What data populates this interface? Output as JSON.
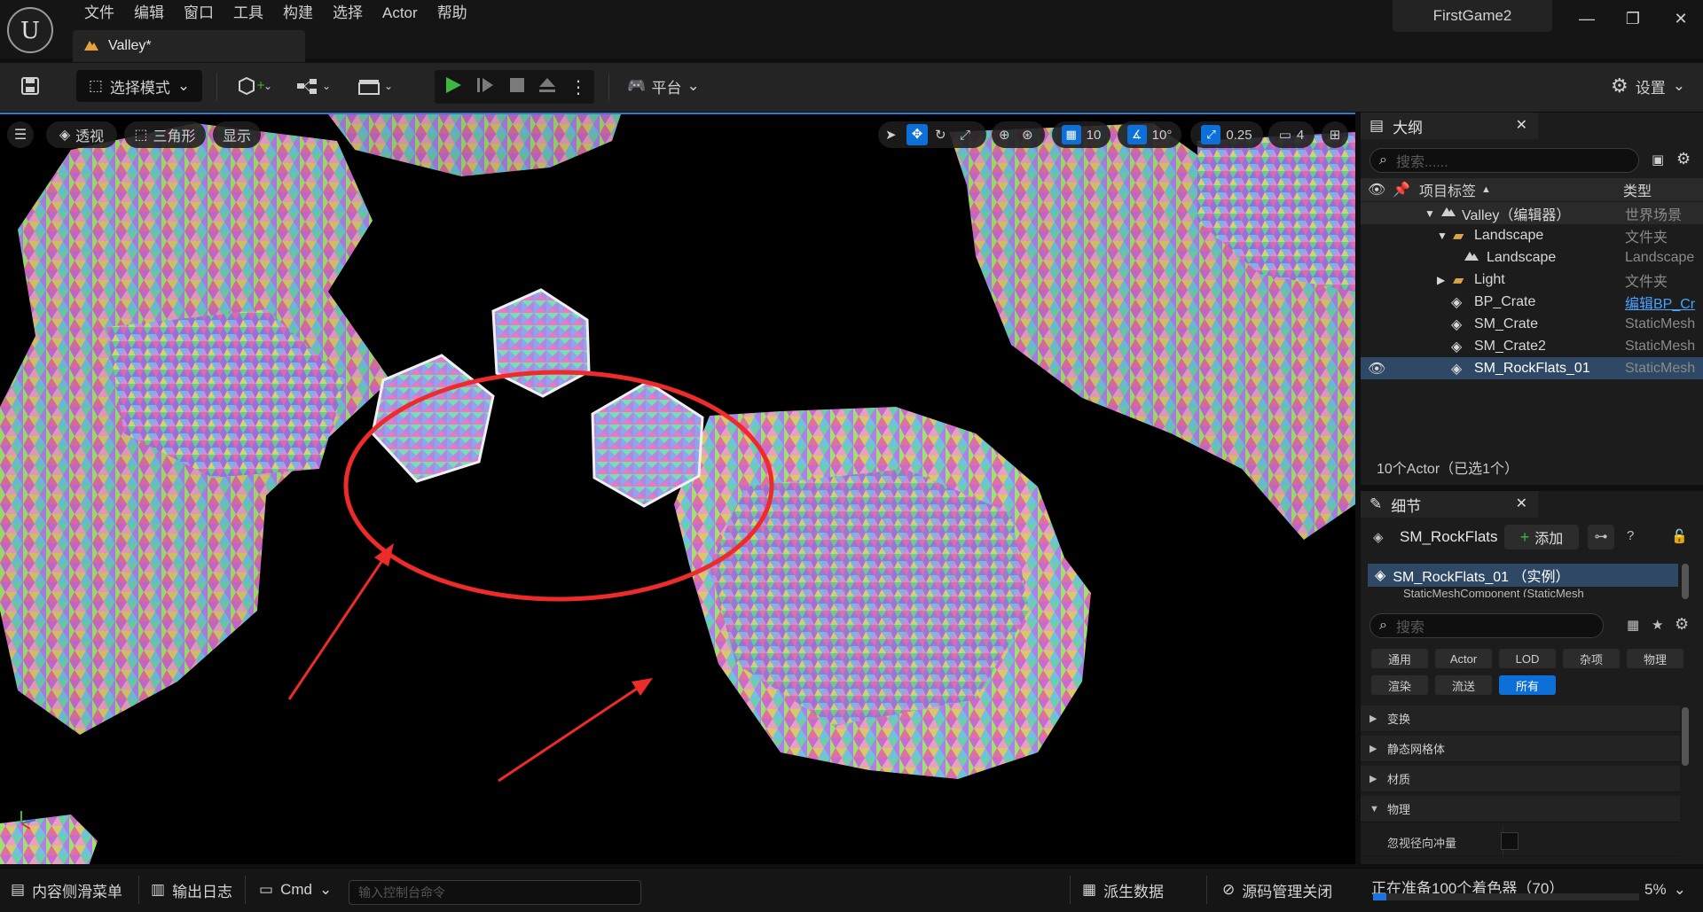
{
  "menu": [
    "文件",
    "编辑",
    "窗口",
    "工具",
    "构建",
    "选择",
    "Actor",
    "帮助"
  ],
  "doc_tab": {
    "label": "Valley*"
  },
  "project_name": "FirstGame2",
  "toolbar": {
    "mode": "选择模式",
    "platform": "平台",
    "settings": "设置"
  },
  "viewport": {
    "perspective": "透视",
    "view_mode": "三角形",
    "show": "显示",
    "grid_snap": "10",
    "rot_snap": "10°",
    "scale_snap": "0.25",
    "camera_speed": "4"
  },
  "outliner": {
    "title": "大纲",
    "search_placeholder": "搜索......",
    "col_label": "项目标签",
    "col_type": "类型",
    "rows": [
      {
        "label": "Valley（编辑器）",
        "type": "世界场景"
      },
      {
        "label": "Landscape",
        "type": "文件夹"
      },
      {
        "label": "Landscape",
        "type": "Landscape"
      },
      {
        "label": "Light",
        "type": "文件夹"
      },
      {
        "label": "BP_Crate",
        "type": "编辑BP_Cr"
      },
      {
        "label": "SM_Crate",
        "type": "StaticMesh"
      },
      {
        "label": "SM_Crate2",
        "type": "StaticMesh"
      },
      {
        "label": "SM_RockFlats_01",
        "type": "StaticMesh"
      }
    ],
    "actor_count": "10个Actor（已选1个）"
  },
  "details": {
    "title": "细节",
    "actor_name": "SM_RockFlats",
    "add_label": "添加",
    "instance_label": "SM_RockFlats_01 （实例）",
    "component_label": "StaticMeshComponent (StaticMesh",
    "search_placeholder": "搜索",
    "categories_row1": [
      "通用",
      "Actor",
      "LOD",
      "杂项",
      "物理"
    ],
    "categories_row2": [
      "渲染",
      "流送",
      "所有"
    ],
    "sections": [
      "变换",
      "静态网格体",
      "材质",
      "物理"
    ],
    "property_label": "忽视径向冲量"
  },
  "statusbar": {
    "content_drawer": "内容侧滑菜单",
    "output_log": "输出日志",
    "cmd": "Cmd",
    "console_placeholder": "输入控制台命令",
    "derived_data": "派生数据",
    "source_control": "源码管理关闭",
    "shader_status": "正在准备100个着色器（70）",
    "progress_percent": "5%",
    "progress_fraction": 0.05
  },
  "colors": {
    "accent": "#0d70d8",
    "play_green": "#3fb83f",
    "annotation_red": "#ee2b2b",
    "selected_row": "#2f4866"
  }
}
